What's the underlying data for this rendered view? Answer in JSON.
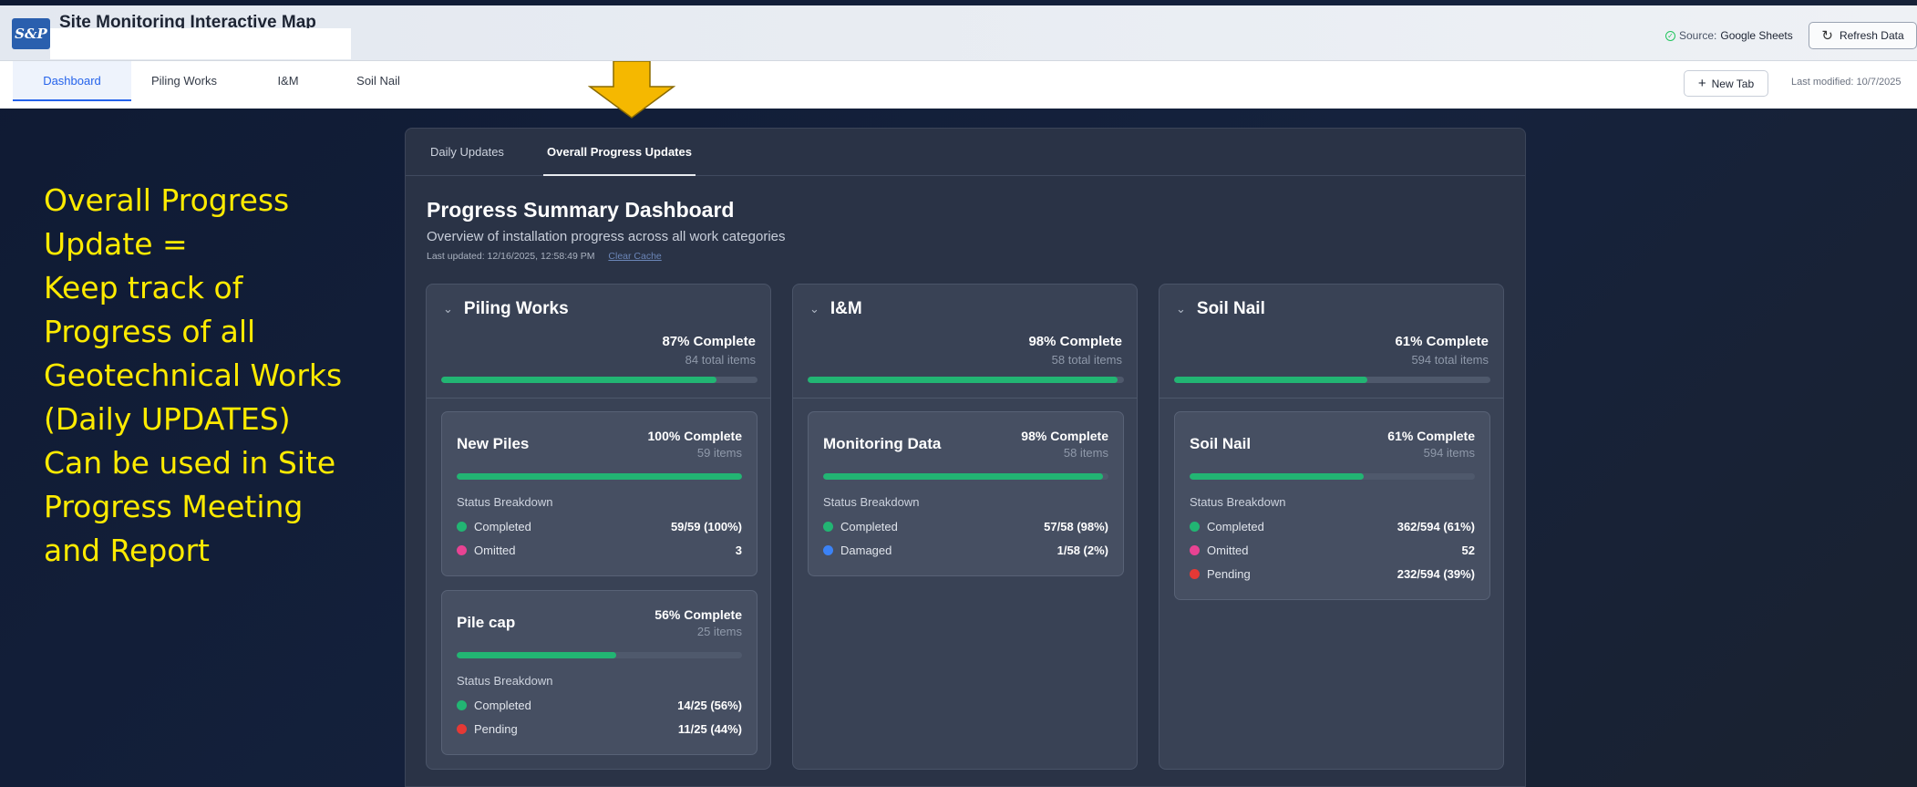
{
  "header": {
    "logo": "S&P",
    "title": "Site Monitoring Interactive Map",
    "source_label": "Source:",
    "source_value": "Google Sheets",
    "refresh_label": "Refresh Data"
  },
  "nav": {
    "tabs": [
      {
        "label": "Dashboard",
        "active": true
      },
      {
        "label": "Piling Works",
        "active": false
      },
      {
        "label": "I&M",
        "active": false
      },
      {
        "label": "Soil Nail",
        "active": false
      }
    ],
    "new_tab_label": "New Tab",
    "last_modified": "Last modified: 10/7/2025"
  },
  "annotation": {
    "lines": [
      "Overall Progress",
      "Update =",
      "Keep track of",
      "Progress of all",
      "Geotechnical Works",
      "(Daily UPDATES)",
      "Can be used in Site",
      "Progress Meeting",
      "and Report"
    ],
    "color": "#ffeb00",
    "arrow_color": "#f5b800"
  },
  "panel": {
    "tabs": [
      {
        "label": "Daily Updates",
        "active": false
      },
      {
        "label": "Overall Progress Updates",
        "active": true
      }
    ],
    "title": "Progress Summary Dashboard",
    "subtitle": "Overview of installation progress across all work categories",
    "updated": "Last updated: 12/16/2025, 12:58:49 PM",
    "clear_cache": "Clear Cache"
  },
  "colors": {
    "progress": "#22b573",
    "completed": "#22b573",
    "omitted": "#e84393",
    "pending": "#e53935",
    "damaged": "#3b82f6"
  },
  "categories": [
    {
      "name": "Piling Works",
      "percent_label": "87% Complete",
      "percent": 87,
      "total": "84 total items",
      "items": [
        {
          "name": "New Piles",
          "percent_label": "100% Complete",
          "percent": 100,
          "count": "59 items",
          "breakdown_label": "Status Breakdown",
          "statuses": [
            {
              "label": "Completed",
              "value": "59/59 (100%)",
              "color": "#22b573"
            },
            {
              "label": "Omitted",
              "value": "3",
              "color": "#e84393"
            }
          ]
        },
        {
          "name": "Pile cap",
          "percent_label": "56% Complete",
          "percent": 56,
          "count": "25 items",
          "breakdown_label": "Status Breakdown",
          "statuses": [
            {
              "label": "Completed",
              "value": "14/25 (56%)",
              "color": "#22b573"
            },
            {
              "label": "Pending",
              "value": "11/25 (44%)",
              "color": "#e53935"
            }
          ]
        }
      ]
    },
    {
      "name": "I&M",
      "percent_label": "98% Complete",
      "percent": 98,
      "total": "58 total items",
      "items": [
        {
          "name": "Monitoring Data",
          "percent_label": "98% Complete",
          "percent": 98,
          "count": "58 items",
          "breakdown_label": "Status Breakdown",
          "statuses": [
            {
              "label": "Completed",
              "value": "57/58 (98%)",
              "color": "#22b573"
            },
            {
              "label": "Damaged",
              "value": "1/58 (2%)",
              "color": "#3b82f6"
            }
          ]
        }
      ]
    },
    {
      "name": "Soil Nail",
      "percent_label": "61% Complete",
      "percent": 61,
      "total": "594 total items",
      "items": [
        {
          "name": "Soil Nail",
          "percent_label": "61% Complete",
          "percent": 61,
          "count": "594 items",
          "breakdown_label": "Status Breakdown",
          "statuses": [
            {
              "label": "Completed",
              "value": "362/594 (61%)",
              "color": "#22b573"
            },
            {
              "label": "Omitted",
              "value": "52",
              "color": "#e84393"
            },
            {
              "label": "Pending",
              "value": "232/594 (39%)",
              "color": "#e53935"
            }
          ]
        }
      ]
    }
  ]
}
